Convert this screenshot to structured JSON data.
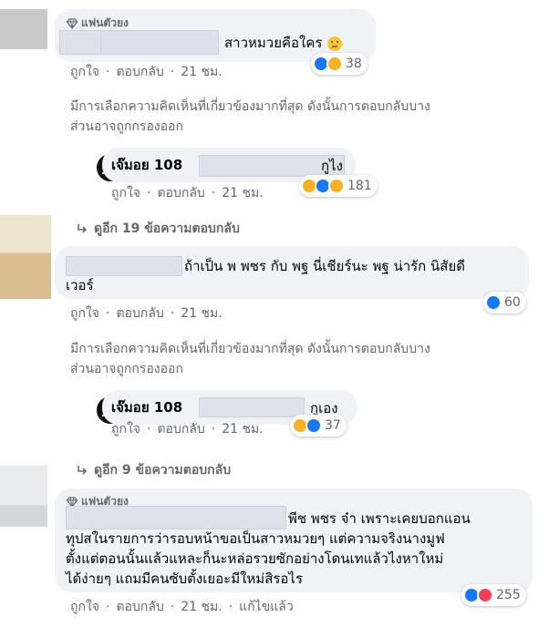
{
  "comments": [
    {
      "badge": "แฟนตัวยง",
      "text": "สาวหมวยคือใคร",
      "reaction_count": "38",
      "actions": {
        "like": "ถูกใจ",
        "reply": "ตอบกลับ",
        "time": "21 ชม."
      }
    },
    {
      "author": "เจ๊มอย 108",
      "text": "กูไง",
      "reaction_count": "181",
      "actions": {
        "like": "ถูกใจ",
        "reply": "ตอบกลับ",
        "time": "21 ชม."
      }
    },
    {
      "text_line1": "ถ้าเป็น พ พชร กับ พฐ นี่เชียร์นะ พฐ น่ารัก นิสัยดี",
      "text_line2": "เวอร์",
      "reaction_count": "60",
      "actions": {
        "like": "ถูกใจ",
        "reply": "ตอบกลับ",
        "time": "21 ชม."
      }
    },
    {
      "author": "เจ๊มอย 108",
      "text": "กูเอง",
      "reaction_count": "37",
      "actions": {
        "like": "ถูกใจ",
        "reply": "ตอบกลับ",
        "time": "21 ชม."
      }
    },
    {
      "badge": "แฟนตัวยง",
      "text_line1": "พีช พชร จ๋า เพราะเคยบอกแอน",
      "text_line2": "ทุปสในรายการว่ารอบหน้าขอเป็นสาวหมวยๆ แต่ความจริงนางมูฟ",
      "text_line3": "ตั้งแต่ตอนนั้นแล้วแหละก็นะหล่อรวยซักอย่างโดนเทแล้วไงหาใหม่",
      "text_line4": "ได้ง่ายๆ แถมมีคนซับตั้งเยอะมีใหม่สิรอไร",
      "reaction_count": "255",
      "actions": {
        "like": "ถูกใจ",
        "reply": "ตอบกลับ",
        "time": "21 ชม.",
        "edited": "แก้ไขแล้ว"
      }
    }
  ],
  "notices": {
    "filtered_line1": "มีการเลือกความคิดเห็นที่เกี่ยวข้องมากที่สุด ดังนั้นการตอบกลับบาง",
    "filtered_line2": "ส่วนอาจถูกกรองออก"
  },
  "view_more": {
    "first": "ดูอีก 19 ข้อความตอบกลับ",
    "second": "ดูอีก 9 ข้อความตอบกลับ"
  },
  "colors": {
    "like_blue": "#1877f2",
    "haha_yellow": "#f7b125",
    "love_red": "#f33e58",
    "bubble_gray": "#f0f2f5",
    "meta_gray": "#65676b"
  }
}
